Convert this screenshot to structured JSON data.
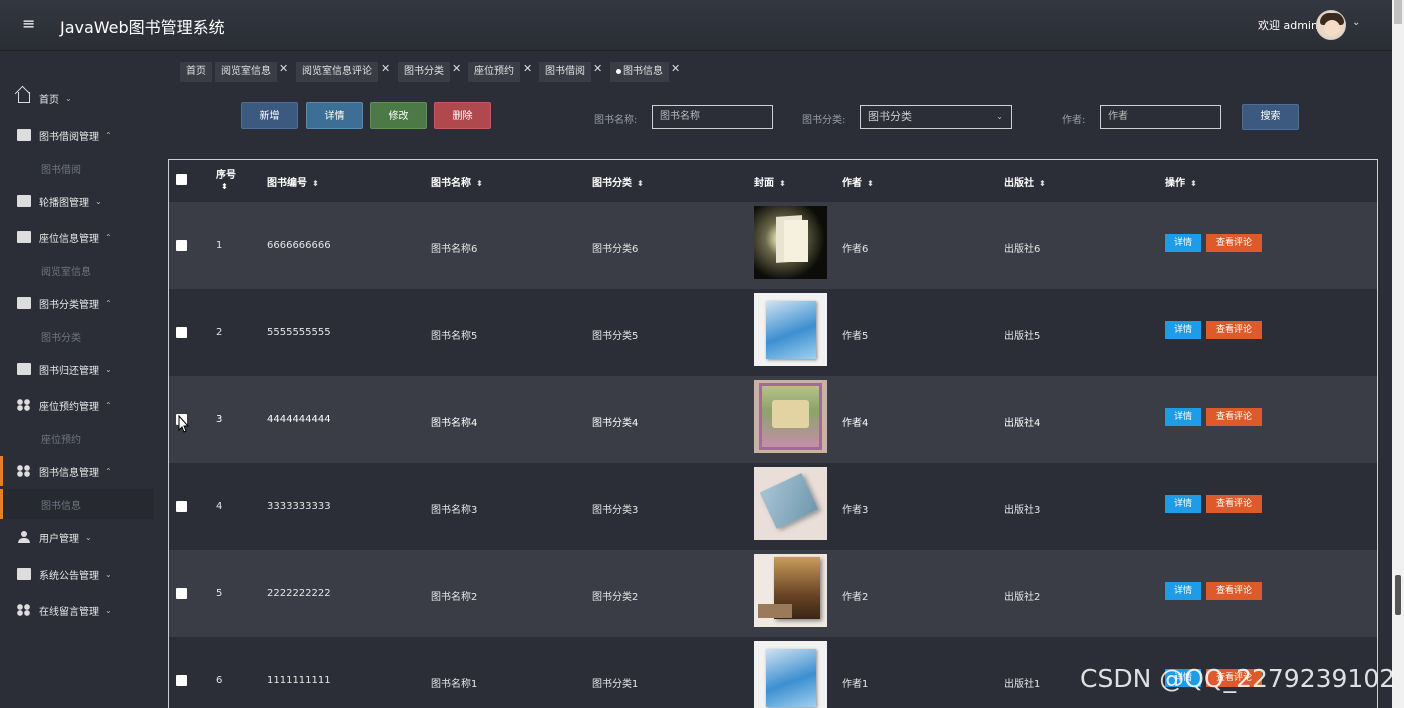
{
  "header": {
    "menu_icon": "hamburger-icon",
    "title": "JavaWeb图书管理系统",
    "welcome": "欢迎 admin",
    "caret_icon": "chevron-down-icon"
  },
  "sidebar": {
    "items": [
      {
        "label": "首页",
        "icon": "home-icon"
      },
      {
        "label": "图书借阅管理",
        "icon": "table-icon",
        "sub": "图书借阅"
      },
      {
        "label": "轮播图管理",
        "icon": "image-icon"
      },
      {
        "label": "座位信息管理",
        "icon": "seat-icon",
        "sub": "阅览室信息"
      },
      {
        "label": "图书分类管理",
        "icon": "chart-icon",
        "sub": "图书分类"
      },
      {
        "label": "图书归还管理",
        "icon": "book-icon"
      },
      {
        "label": "座位预约管理",
        "icon": "grid-icon",
        "sub": "座位预约"
      },
      {
        "label": "图书信息管理",
        "icon": "grid-icon",
        "sub": "图书信息"
      },
      {
        "label": "用户管理",
        "icon": "user-icon"
      },
      {
        "label": "系统公告管理",
        "icon": "notice-icon"
      },
      {
        "label": "在线留言管理",
        "icon": "grid-icon"
      }
    ],
    "accent": "#e0822a"
  },
  "tabs": [
    {
      "label": "首页"
    },
    {
      "label": "阅览室信息"
    },
    {
      "label": "阅览室信息评论"
    },
    {
      "label": "图书分类"
    },
    {
      "label": "座位预约"
    },
    {
      "label": "图书借阅"
    },
    {
      "label": "图书信息"
    }
  ],
  "toolbar": {
    "new_label": "新增",
    "detail_label": "详情",
    "edit_label": "修改",
    "delete_label": "删除",
    "search_label": "搜索"
  },
  "filters": {
    "name_label": "图书名称:",
    "name_placeholder": "图书名称",
    "category_label": "图书分类:",
    "category_value": "图书分类",
    "author_label": "作者:",
    "author_placeholder": "作者"
  },
  "table": {
    "columns": [
      "序号",
      "图书编号",
      "图书名称",
      "图书分类",
      "封面",
      "作者",
      "出版社",
      "操作"
    ],
    "rows": [
      {
        "index": "1",
        "code": "6666666666",
        "name": "图书名称6",
        "category": "图书分类6",
        "author": "作者6",
        "publisher": "出版社6"
      },
      {
        "index": "2",
        "code": "5555555555",
        "name": "图书名称5",
        "category": "图书分类5",
        "author": "作者5",
        "publisher": "出版社5"
      },
      {
        "index": "3",
        "code": "4444444444",
        "name": "图书名称4",
        "category": "图书分类4",
        "author": "作者4",
        "publisher": "出版社4"
      },
      {
        "index": "4",
        "code": "3333333333",
        "name": "图书名称3",
        "category": "图书分类3",
        "author": "作者3",
        "publisher": "出版社3"
      },
      {
        "index": "5",
        "code": "2222222222",
        "name": "图书名称2",
        "category": "图书分类2",
        "author": "作者2",
        "publisher": "出版社2"
      },
      {
        "index": "6",
        "code": "1111111111",
        "name": "图书名称1",
        "category": "图书分类1",
        "author": "作者1",
        "publisher": "出版社1"
      }
    ],
    "row_detail_label": "详情",
    "row_comment_label": "查看评论",
    "detail_color": "#1e9ce8",
    "comment_color": "#de5a2a"
  },
  "watermark": "CSDN @QQ_2279239102"
}
